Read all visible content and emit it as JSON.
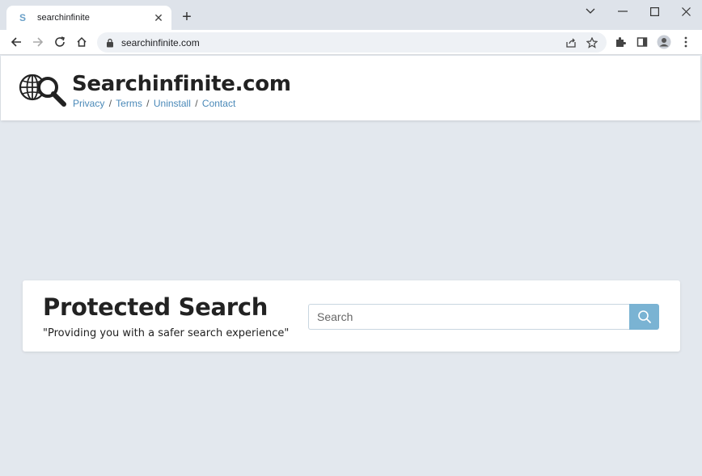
{
  "browser": {
    "tab_title": "searchinfinite",
    "tab_favicon": "S",
    "url": "searchinfinite.com",
    "icons": [
      "back-icon",
      "forward-icon",
      "reload-icon",
      "home-icon",
      "lock-icon",
      "share-icon",
      "star-icon",
      "extensions-icon",
      "side-panel-icon",
      "profile-icon",
      "menu-icon",
      "minimize-icon",
      "maximize-icon",
      "close-icon",
      "chevron-down-icon",
      "new-tab-icon"
    ]
  },
  "site": {
    "name": "Searchinfinite.com",
    "links": [
      "Privacy",
      "Terms",
      "Uninstall",
      "Contact"
    ],
    "separator": "/"
  },
  "card": {
    "title": "Protected Search",
    "subtitle": "\"Providing you with a safer search experience\"",
    "search_placeholder": "Search"
  },
  "colors": {
    "accent": "#7ab3d3",
    "link": "#4a89b8",
    "page_bg": "#e3e8ee"
  }
}
